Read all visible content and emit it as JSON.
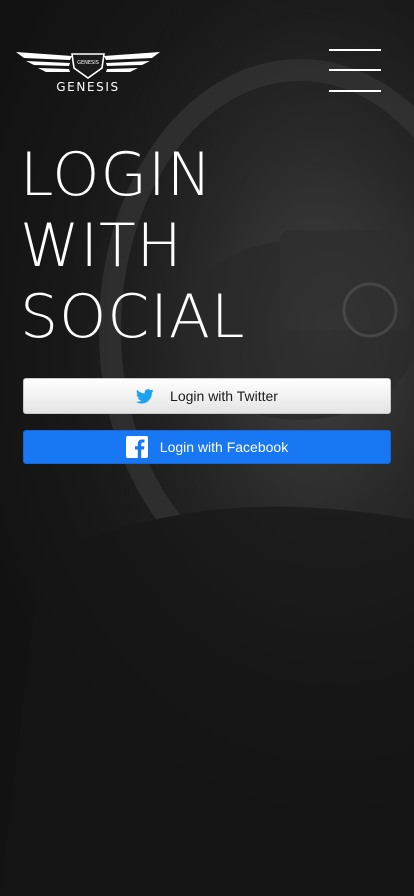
{
  "brand": {
    "badge_text": "GENESIS",
    "wordmark": "GENESIS"
  },
  "header": {
    "menu_icon": "hamburger-menu-icon"
  },
  "hero": {
    "lines": [
      "LOGIN",
      "WITH",
      "SOCIAL"
    ]
  },
  "buttons": {
    "twitter": {
      "label": "Login with Twitter",
      "icon": "twitter-bird-icon",
      "icon_color": "#1da1f2"
    },
    "facebook": {
      "label": "Login with Facebook",
      "icon": "facebook-icon",
      "bg_color": "#1877f2"
    }
  },
  "colors": {
    "background": "#141414",
    "text": "#ffffff"
  }
}
